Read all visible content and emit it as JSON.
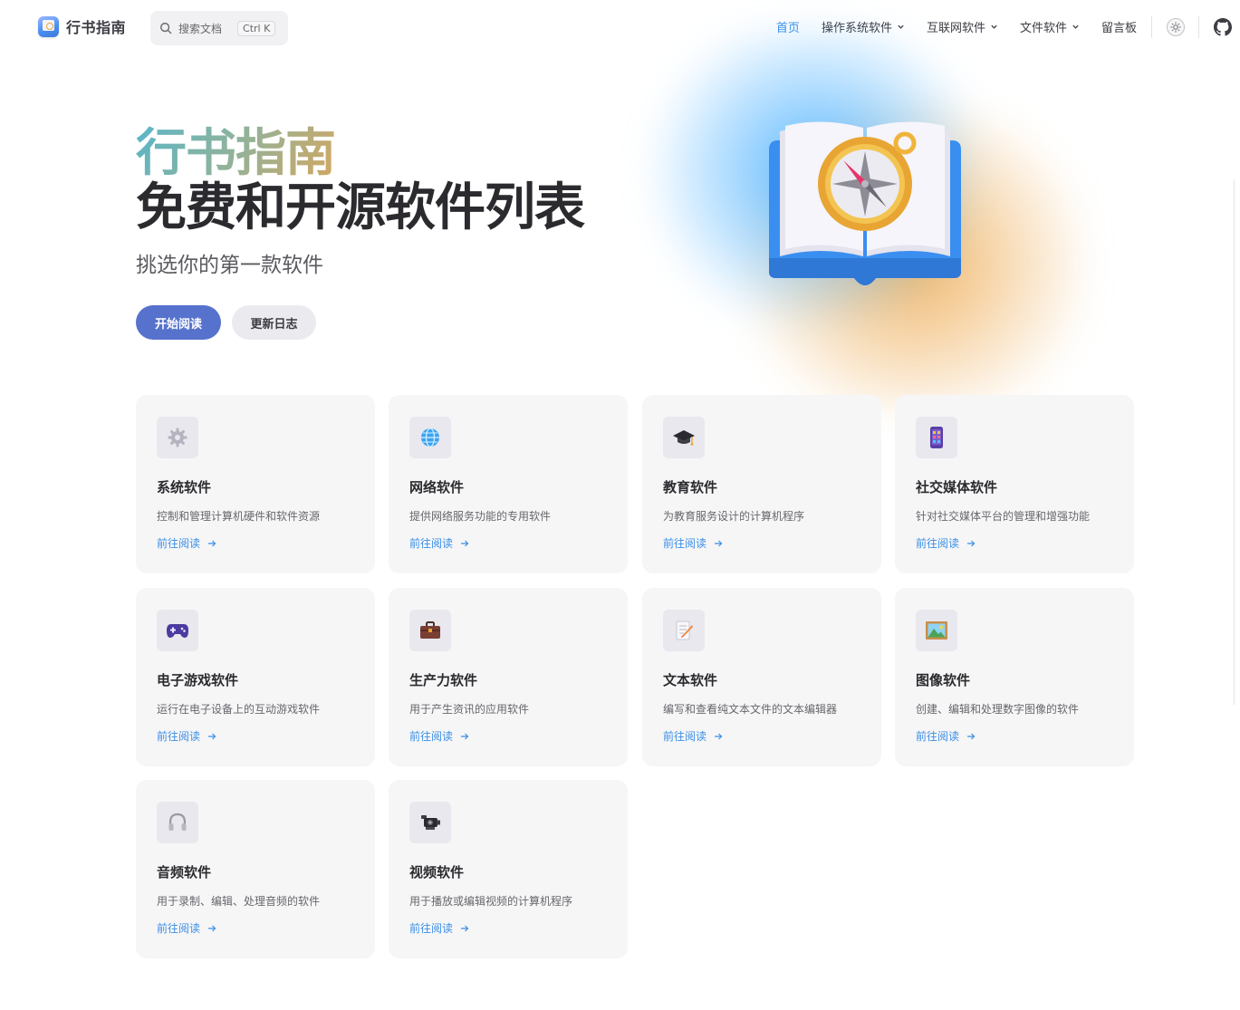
{
  "brand": {
    "name": "行书指南"
  },
  "search": {
    "placeholder": "搜索文档",
    "shortcut": "Ctrl K"
  },
  "nav": {
    "items": [
      {
        "label": "首页",
        "active": true,
        "dropdown": false
      },
      {
        "label": "操作系统软件",
        "active": false,
        "dropdown": true
      },
      {
        "label": "互联网软件",
        "active": false,
        "dropdown": true
      },
      {
        "label": "文件软件",
        "active": false,
        "dropdown": true
      },
      {
        "label": "留言板",
        "active": false,
        "dropdown": false
      }
    ]
  },
  "hero": {
    "name": "行书指南",
    "text": "免费和开源软件列表",
    "tagline": "挑选你的第一款软件",
    "actions": {
      "primary": "开始阅读",
      "secondary": "更新日志"
    }
  },
  "colors": {
    "accent": "#3a8ee6",
    "brand_button": "#5672cd",
    "card_bg": "#f6f6f7"
  },
  "features": [
    {
      "icon": "gear-icon",
      "title": "系统软件",
      "desc": "控制和管理计算机硬件和软件资源",
      "link": "前往阅读"
    },
    {
      "icon": "globe-icon",
      "title": "网络软件",
      "desc": "提供网络服务功能的专用软件",
      "link": "前往阅读"
    },
    {
      "icon": "graduation-cap-icon",
      "title": "教育软件",
      "desc": "为教育服务设计的计算机程序",
      "link": "前往阅读"
    },
    {
      "icon": "phone-icon",
      "title": "社交媒体软件",
      "desc": "针对社交媒体平台的管理和增强功能",
      "link": "前往阅读"
    },
    {
      "icon": "gamepad-icon",
      "title": "电子游戏软件",
      "desc": "运行在电子设备上的互动游戏软件",
      "link": "前往阅读"
    },
    {
      "icon": "briefcase-icon",
      "title": "生产力软件",
      "desc": "用于产生资讯的应用软件",
      "link": "前往阅读"
    },
    {
      "icon": "memo-icon",
      "title": "文本软件",
      "desc": "编写和查看纯文本文件的文本编辑器",
      "link": "前往阅读"
    },
    {
      "icon": "picture-icon",
      "title": "图像软件",
      "desc": "创建、编辑和处理数字图像的软件",
      "link": "前往阅读"
    },
    {
      "icon": "headphones-icon",
      "title": "音频软件",
      "desc": "用于录制、编辑、处理音频的软件",
      "link": "前往阅读"
    },
    {
      "icon": "projector-icon",
      "title": "视频软件",
      "desc": "用于播放或编辑视频的计算机程序",
      "link": "前往阅读"
    }
  ]
}
